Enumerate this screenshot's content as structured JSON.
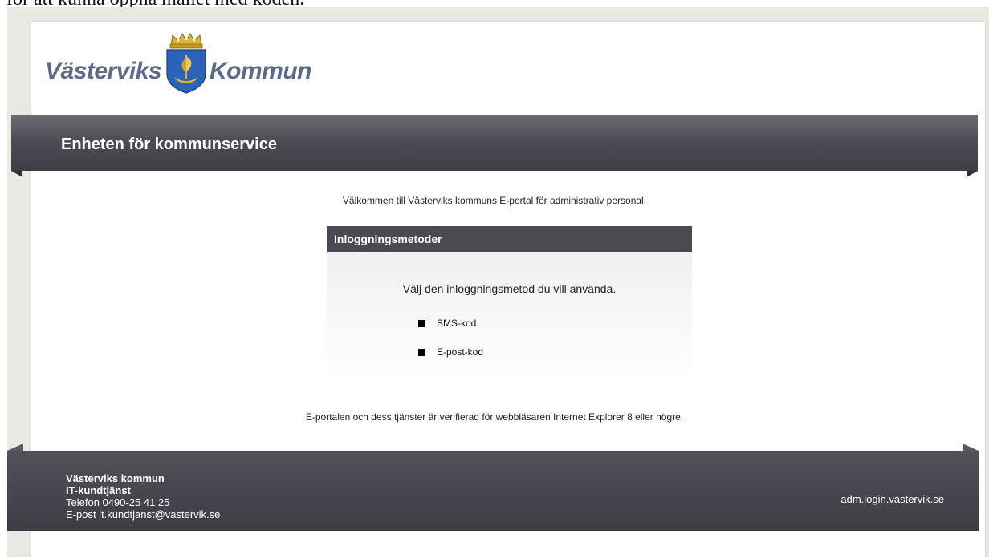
{
  "overflow_text": "för att kunna öppna mailet med koden.",
  "brand": {
    "logo_left": "Västerviks",
    "logo_right": "Kommun"
  },
  "banner": {
    "title": "Enheten för kommunservice"
  },
  "welcome": "Välkommen till Västerviks kommuns E-portal för administrativ personal.",
  "login": {
    "header": "Inloggningsmetoder",
    "instruction": "Välj den inloggningsmetod du vill använda.",
    "methods": [
      {
        "label": "SMS-kod",
        "icon": "square-bullet-icon"
      },
      {
        "label": "E-post-kod",
        "icon": "square-bullet-icon"
      }
    ]
  },
  "browser_note": "E-portalen och dess tjänster är verifierad för webbläsaren Internet Explorer 8 eller högre.",
  "footer": {
    "org": "Västerviks kommun",
    "dept": "IT-kundtjänst",
    "phone": "Telefon 0490-25 41 25",
    "email": "E-post it.kundtjanst@vastervik.se",
    "host": "adm.login.vastervik.se"
  },
  "colors": {
    "banner": "#4d4e55",
    "footer": "#3c3d44",
    "logo_text": "#5d6b8a",
    "crest_blue": "#2a63b8",
    "crest_gold": "#d8b23a"
  }
}
